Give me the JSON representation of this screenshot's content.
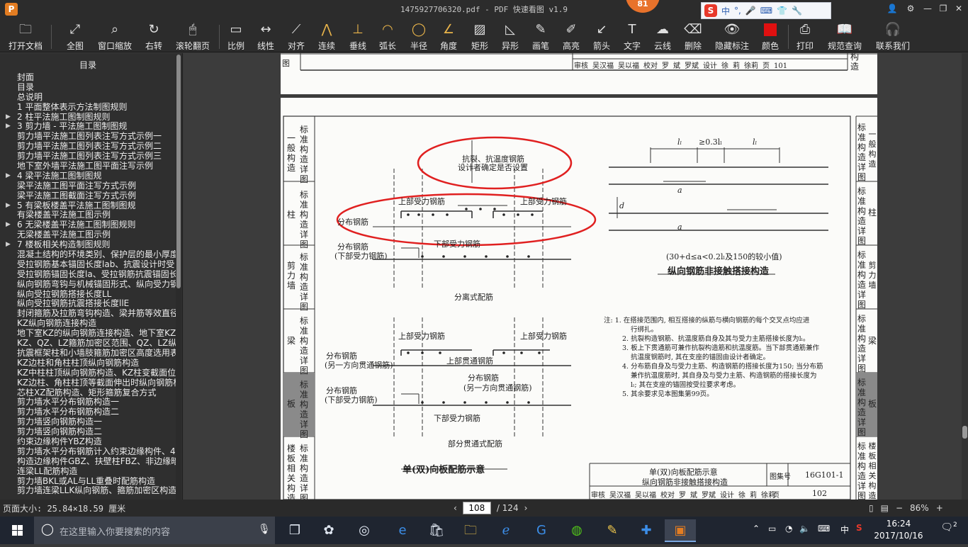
{
  "window": {
    "app_logo": "P",
    "title": "1475927706320.pdf - PDF 快速看图 v1.9",
    "badge": "81",
    "ime": {
      "logo": "S",
      "lang": "中"
    }
  },
  "toolbar": {
    "items": [
      {
        "label": "打开文档",
        "icon": "folder-icon"
      },
      {
        "label": "全图",
        "icon": "fit-icon"
      },
      {
        "label": "窗口缩放",
        "icon": "zoom-icon"
      },
      {
        "label": "右转",
        "icon": "rotate-icon"
      },
      {
        "label": "滚轮翻页",
        "icon": "mouse-icon"
      },
      {
        "label": "比例",
        "icon": "scale-icon"
      },
      {
        "label": "线性",
        "icon": "linear-icon"
      },
      {
        "label": "对齐",
        "icon": "align-icon"
      },
      {
        "label": "连续",
        "icon": "continuous-icon"
      },
      {
        "label": "垂线",
        "icon": "perpendicular-icon"
      },
      {
        "label": "弧长",
        "icon": "arc-icon"
      },
      {
        "label": "半径",
        "icon": "radius-icon"
      },
      {
        "label": "角度",
        "icon": "angle-icon"
      },
      {
        "label": "矩形",
        "icon": "rectangle-icon"
      },
      {
        "label": "异形",
        "icon": "shape-icon"
      },
      {
        "label": "画笔",
        "icon": "pen-icon"
      },
      {
        "label": "高亮",
        "icon": "highlight-icon"
      },
      {
        "label": "箭头",
        "icon": "arrow-icon"
      },
      {
        "label": "文字",
        "icon": "text-icon"
      },
      {
        "label": "云线",
        "icon": "cloud-icon"
      },
      {
        "label": "删除",
        "icon": "eraser-icon"
      },
      {
        "label": "隐藏标注",
        "icon": "eye-icon"
      },
      {
        "label": "颜色",
        "icon": "color-icon"
      },
      {
        "label": "打印",
        "icon": "printer-icon"
      },
      {
        "label": "规范查询",
        "icon": "book-icon"
      },
      {
        "label": "联系我们",
        "icon": "headset-icon"
      }
    ],
    "color_swatch": "#e01010"
  },
  "sidebar": {
    "title": "目录",
    "items": [
      {
        "text": "封面",
        "arrow": false
      },
      {
        "text": "目录",
        "arrow": false
      },
      {
        "text": "总说明",
        "arrow": false
      },
      {
        "text": "1 平面整体表示方法制图规则",
        "arrow": false
      },
      {
        "text": "2 柱平法施工图制图规则",
        "arrow": true
      },
      {
        "text": "3 剪力墙 - 平法施工图制图规",
        "arrow": true
      },
      {
        "text": "剪力墙平法施工图列表注写方式示例一",
        "arrow": false
      },
      {
        "text": "剪力墙平法施工图列表注写方式示例二",
        "arrow": false
      },
      {
        "text": "剪力墙平法施工图列表注写方式示例三",
        "arrow": false
      },
      {
        "text": "地下室外墙平法施工图平面注写示例",
        "arrow": false
      },
      {
        "text": "4 梁平法施工图制图规",
        "arrow": true
      },
      {
        "text": "梁平法施工图平面注写方式示例",
        "arrow": false
      },
      {
        "text": "梁平法施工图截面注写方式示例",
        "arrow": false
      },
      {
        "text": "5 有梁板楼盖平法施工图制图规",
        "arrow": true
      },
      {
        "text": "有梁楼盖平法施工图示例",
        "arrow": false
      },
      {
        "text": "6 无梁楼盖平法施工图制图规则",
        "arrow": true
      },
      {
        "text": "无梁楼盖平法施工图示例",
        "arrow": false
      },
      {
        "text": "7 楼板相关构造制图规则",
        "arrow": true
      },
      {
        "text": "混凝土结构的环境类别、保护层的最小厚度",
        "arrow": false
      },
      {
        "text": "受拉钢筋基本锚固长度lab、抗震设计时受",
        "arrow": false
      },
      {
        "text": "受拉钢筋锚固长度la、受拉钢筋抗震锚固长",
        "arrow": false
      },
      {
        "text": "纵向钢筋弯钩与机械锚固形式、纵向受力钢",
        "arrow": false
      },
      {
        "text": "纵向受拉钢筋搭接长度LL",
        "arrow": false
      },
      {
        "text": "纵向受拉钢筋抗震搭接长度llE",
        "arrow": false
      },
      {
        "text": "封闭箍筋及拉筋弯钩构造、梁并筋等效直径",
        "arrow": false
      },
      {
        "text": "KZ纵向钢筋连接构造",
        "arrow": false
      },
      {
        "text": "地下室KZ的纵向钢筋连接构造、地下室KZ的",
        "arrow": false
      },
      {
        "text": "KZ、QZ、LZ箍筋加密区范围、QZ、LZ纵向钢",
        "arrow": false
      },
      {
        "text": "抗震框架柱和小墙肢箍筋加密区高度选用表",
        "arrow": false
      },
      {
        "text": "KZ边柱和角柱柱顶纵向钢筋构造",
        "arrow": false
      },
      {
        "text": "KZ中柱柱顶纵向钢筋构造、KZ柱变截面位置",
        "arrow": false
      },
      {
        "text": "KZ边柱、角柱柱顶等截面伸出时纵向钢筋构",
        "arrow": false
      },
      {
        "text": "芯柱XZ配筋构造、矩形箍筋复合方式",
        "arrow": false
      },
      {
        "text": "剪力墙水平分布钢筋构造一",
        "arrow": false
      },
      {
        "text": "剪力墙水平分布钢筋构造二",
        "arrow": false
      },
      {
        "text": "剪力墙竖向钢筋构造一",
        "arrow": false
      },
      {
        "text": "剪力墙竖向钢筋构造二",
        "arrow": false
      },
      {
        "text": "约束边缘构件YBZ构造",
        "arrow": false
      },
      {
        "text": "剪力墙水平分布钢筋计入约束边缘构件、4",
        "arrow": false
      },
      {
        "text": "构造边缘构件GBZ、扶壁柱FBZ、非边缘暗柱",
        "arrow": false
      },
      {
        "text": "连梁LL配筋构造",
        "arrow": false
      },
      {
        "text": "剪力墙BKL或AL与LL重叠时配筋构造",
        "arrow": false
      },
      {
        "text": "剪力墙连梁LLK纵向钢筋、箍筋加密区构造",
        "arrow": false
      }
    ]
  },
  "page_top": {
    "title_block": [
      "审核",
      "吴汉福",
      "吴以福",
      "校对",
      "罗",
      "斌",
      "罗斌",
      "设计",
      "徐",
      "莉",
      "徐莉",
      "页",
      "101"
    ],
    "right_tab": "构造"
  },
  "page_main": {
    "left_tabs": [
      "一般构造",
      "标准构造详图",
      "柱",
      "标准构造详图",
      "剪力墙",
      "标准构造详图",
      "梁",
      "标准构造详图",
      "板",
      "标准构造详图",
      "楼板相关构造",
      "标准构造详图"
    ],
    "right_tabs": [
      "标准构造详图",
      "一般构造",
      "标准构造详图",
      "柱",
      "标准构造详图",
      "剪力墙",
      "标准构造详图",
      "梁",
      "标准构造详图",
      "板",
      "标准构造详图",
      "楼板相关构造"
    ],
    "labels": {
      "anti_crack": "抗裂、抗温度钢筋",
      "designer_decides": "设计者确定是否设置",
      "top_bar_left": "上部受力钢筋",
      "top_bar_right": "上部受力钢筋",
      "dist_bar": "分布钢筋",
      "dist_bar_2": "分布钢筋",
      "lower_bar_paren": "(下部受力钢筋)",
      "lower_bar": "下部受力钢筋",
      "separate": "分离式配筋",
      "top_bar_left2": "上部受力钢筋",
      "top_bar_right2": "上部受力钢筋",
      "dist_bar_3": "分布钢筋",
      "other_dir": "(另一方向贯通钢筋)",
      "top_through": "上部贯通钢筋",
      "dist_bar_4": "分布钢筋",
      "other_dir_2": "(另一方向贯通钢筋)",
      "dist_bar_5": "分布钢筋",
      "lower_bar_paren_2": "(下部受力钢筋)",
      "lower_bar_2": "下部受力钢筋",
      "partial_through": "部分贯通式配筋",
      "drawing_title": "单(双)向板配筋示意",
      "ll1": "lₗ",
      "gap": "≥0.3lₗ",
      "ll2": "lₗ",
      "dim_d": "d",
      "dim_a1": "a",
      "dim_a2": "a",
      "cond": "(30+d≤a<0.2lₗ及150的较小值)",
      "lap_title": "纵向钢筋非接触搭接构造"
    },
    "notes": [
      "注: 1. 在搭接范围内, 相互搭接的纵筋与横向钢筋的每个交叉点均应进",
      "行绑扎。",
      "2. 抗裂构造钢筋、抗温度筋自身及其与受力主筋搭接长度为lₗ。",
      "3. 板上下贯通筋可兼作抗裂构造筋和抗温度筋。当下部贯通筋兼作",
      "抗温度钢筋时, 其在支座的锚固由设计者确定。",
      "4. 分布筋自身及与受力主筋、构造钢筋的搭接长度为150; 当分布筋",
      "兼作抗温度筋时, 其自身及与受力主筋、构造钢筋的搭接长度为",
      "lₗ; 其在支座的锚固按受拉要求考虑。",
      "5. 其余要求见本图集第99页。"
    ],
    "title_block": {
      "title1": "单(双)向板配筋示意",
      "title2": "纵向钢筋非接触搭接构造",
      "atlas_label": "图集号",
      "atlas_no": "16G101-1",
      "page_label": "页",
      "page_no": "102",
      "signers": [
        "审核",
        "吴汉福",
        "吴以福",
        "校对",
        "罗",
        "斌",
        "罗斌",
        "设计",
        "徐",
        "莉",
        "徐莉"
      ]
    }
  },
  "status": {
    "page_size": "页面大小: 25.84×18.59 厘米",
    "current_page": "108",
    "total_pages": "/ 124",
    "zoom": "86%",
    "zoom_minus": "−",
    "zoom_plus": "+"
  },
  "taskbar": {
    "search_placeholder": "在这里输入你要搜索的内容",
    "time": "16:24",
    "date": "2017/10/16",
    "ime": "中",
    "notify_count": "2"
  }
}
